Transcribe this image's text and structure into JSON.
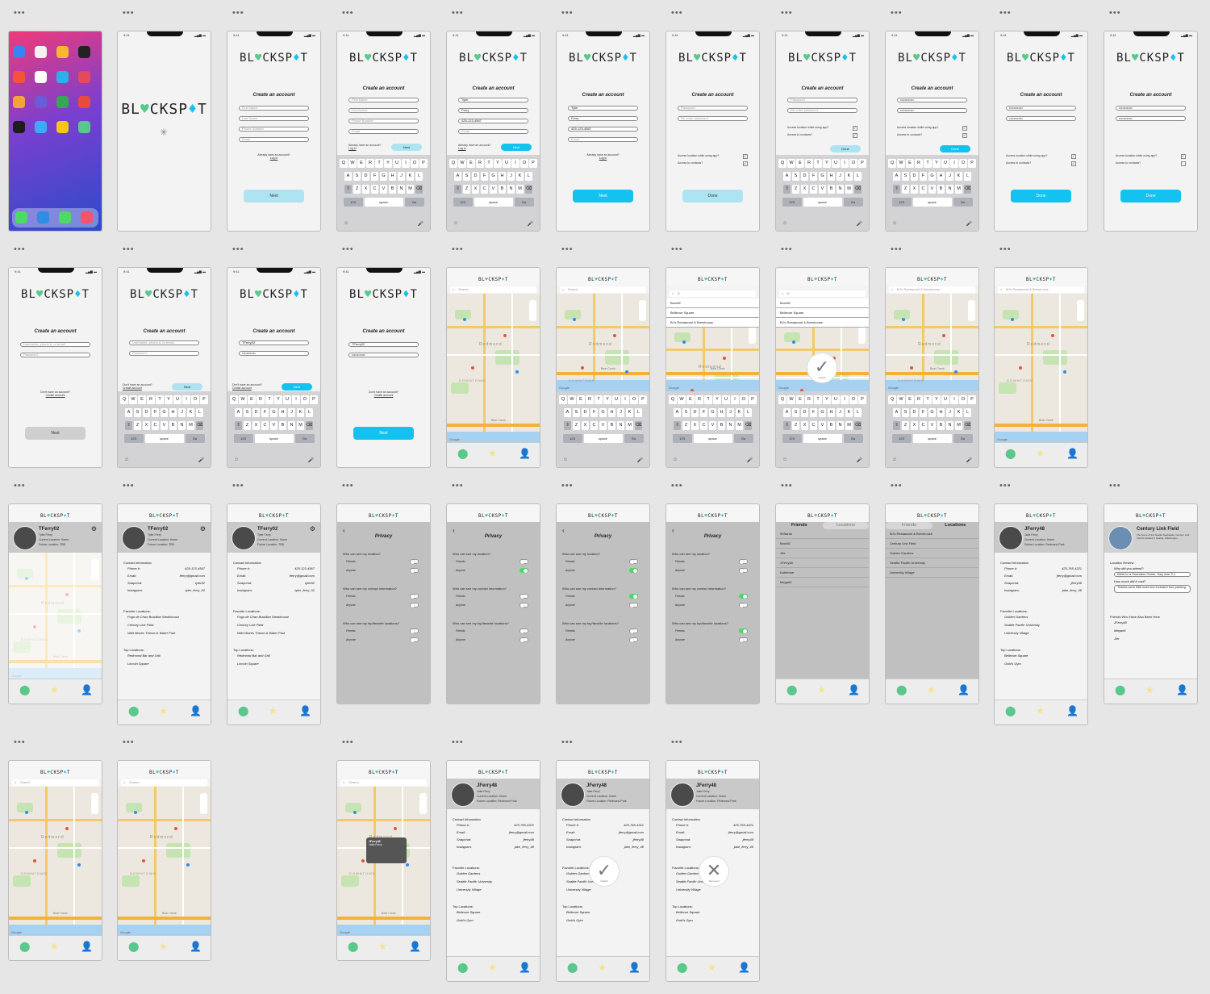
{
  "app": {
    "name_part1": "BL",
    "name_heart": "♥",
    "name_part2": "CKSP",
    "name_pin": "♦",
    "name_part3": "T",
    "brand_color": "#14c2ef",
    "accent_green": "#58c98a"
  },
  "status": {
    "time": "9:41",
    "signal": "▂▄▆ ▬"
  },
  "dots": "•••",
  "signup": {
    "title": "Create an account",
    "first_name": "First Name",
    "last_name": "Last Name",
    "phone": "Phone Number",
    "email": "Email",
    "already": "Already have an account?",
    "login": "Log in",
    "next": "Next",
    "first_val": "Tyler",
    "last_val": "Ferry",
    "phone_val": "425-123-4567",
    "password": "Password",
    "reenter": "Re-enter password",
    "mask": "••••••••••••",
    "location_q": "Access location while using app?",
    "contacts_q": "Access to contacts?",
    "done": "Done",
    "user_ph": "Username, phone #, or email",
    "dont": "Don't have an account?",
    "create": "Create account",
    "user_val": "TFerry02"
  },
  "keyboard": {
    "row1": [
      "Q",
      "W",
      "E",
      "R",
      "T",
      "Y",
      "U",
      "I",
      "O",
      "P"
    ],
    "row2": [
      "A",
      "S",
      "D",
      "F",
      "G",
      "H",
      "J",
      "K",
      "L"
    ],
    "row3": [
      "Z",
      "X",
      "C",
      "V",
      "B",
      "N",
      "M"
    ],
    "shift": "⇧",
    "back": "⌫",
    "num": "123",
    "space": "space",
    "go": "Go",
    "emoji": "☺",
    "mic": "🎤"
  },
  "map": {
    "search": "Search",
    "typed": "B",
    "results": [
      "Brod92",
      "Bellevue Square",
      "BJ's Restaurant & Brewhouse"
    ],
    "selected": "BJ's Restaurant & Brewhouse",
    "labels": [
      "Redmond",
      "DOWNTOWN",
      "Bear Creek"
    ],
    "google": "Google",
    "added": "Added!",
    "popup_name": "JFerry48",
    "popup_sub": "Jake Ferry"
  },
  "profile": {
    "user": "TFerry02",
    "real": "Tyler Ferry",
    "current": "Current Location: Home",
    "future": "Future Location: TBD",
    "contact_hd": "Contact Information",
    "phone_k": "Phone #:",
    "phone_v": "425-123-4567",
    "email_k": "Email:",
    "email_v": "tferry@gmail.com",
    "snap_k": "Snapchat:",
    "snap_v": "tyler92",
    "insta_k": "Instagram:",
    "insta_v": "tyler_ferry_02",
    "fav_hd": "Favorite Locations:",
    "favs": [
      "Fogo de Chao Brazilian Steakhouse",
      "Century Link Field",
      "Wild Waves Theme & Water Park"
    ],
    "top_hd": "Top Locations:",
    "tops": [
      "Redmond Bar and Grill",
      "Lincoln Square"
    ]
  },
  "privacy": {
    "title": "Privacy",
    "back": "‹",
    "q1": "Who can see my location?",
    "q2": "Who can see my contact information?",
    "q3": "Who can see my top/favorite locations?",
    "friends": "Friends",
    "anyone": "Anyone"
  },
  "friends": {
    "tab1": "Friends",
    "tab2": "Locations",
    "list": [
      "99Sarah",
      "Brod92",
      "J0e",
      "JFerry48",
      "Katherine",
      "MeganK"
    ],
    "locations": [
      "BJ's Restaurant & Brewhouse",
      "Century Link Field",
      "Golden Gardens",
      "Seattle Pacific University",
      "University Village"
    ]
  },
  "jferry": {
    "user": "JFerry48",
    "real": "Jake Ferry",
    "current": "Current Location: Home",
    "future": "Future Location: Redmond Park",
    "phone_v": "425-765-4321",
    "email_v": "jferry@gmail.com",
    "snap_v": "jferry48",
    "insta_v": "jake_ferry_48",
    "favs": [
      "Golden Gardens",
      "Seattle Pacific University",
      "University Village"
    ],
    "tops": [
      "Bellevue Square",
      "Gold's Gym"
    ],
    "added": "Added!",
    "removed": "Removed"
  },
  "field": {
    "title": "Century Link Field",
    "desc": "The home of the Seattle Seahawks, Century Link Field is located in Seattle, Washington.",
    "review_hd": "Location Review",
    "why": "Why did you attend?",
    "why_a": "Went to a Sounders Game, they won 2-1",
    "cost": "How much did it cost?",
    "cost_a": "Tickets were $80 each but included free parking",
    "friends_hd": "Friends Who Have Also Been Here",
    "friends": [
      "JFerry48",
      "MeganK",
      "J0e"
    ]
  }
}
